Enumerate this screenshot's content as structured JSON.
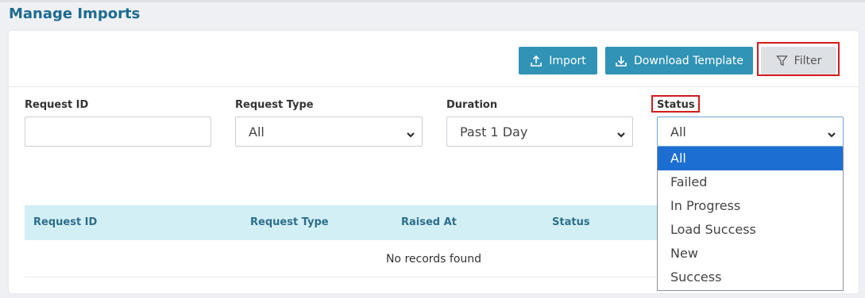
{
  "page": {
    "title": "Manage Imports"
  },
  "toolbar": {
    "import_label": "Import",
    "download_template_label": "Download Template",
    "filter_label": "Filter"
  },
  "filters": {
    "request_id": {
      "label": "Request ID",
      "value": ""
    },
    "request_type": {
      "label": "Request Type",
      "value": "All"
    },
    "duration": {
      "label": "Duration",
      "value": "Past 1 Day"
    },
    "status": {
      "label": "Status",
      "value": "All",
      "options": [
        "All",
        "Failed",
        "In Progress",
        "Load Success",
        "New",
        "Success"
      ]
    }
  },
  "table": {
    "columns": [
      "Request ID",
      "Request Type",
      "Raised At",
      "Status"
    ],
    "empty_message": "No records found"
  },
  "colors": {
    "primary_button": "#3193b5",
    "title": "#1d6a8f",
    "highlight": "#d21b1b",
    "table_header_bg": "#d3eff6",
    "selected_option": "#1c6ed3"
  },
  "icons": {
    "import": "upload-icon",
    "download": "download-icon",
    "filter": "filter-icon",
    "select_caret": "chevron-down-icon"
  }
}
